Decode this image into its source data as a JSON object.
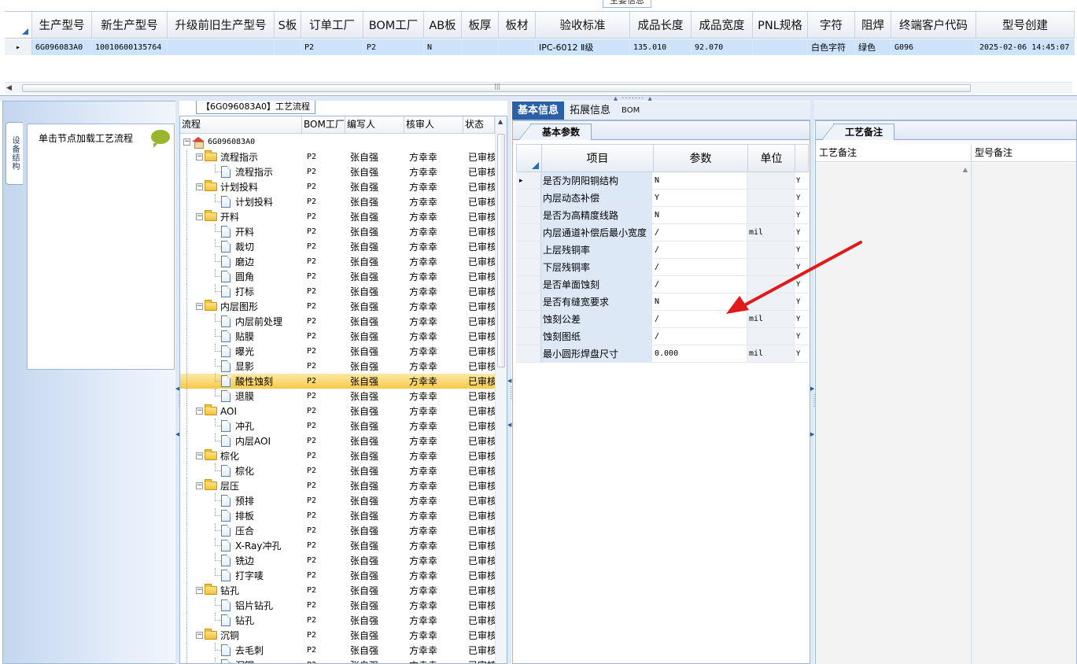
{
  "top_grid": {
    "caption": "主要信息",
    "columns": [
      {
        "label": "生产型号",
        "w": 76
      },
      {
        "label": "新生产型号",
        "w": 96
      },
      {
        "label": "升级前旧生产型号",
        "w": 136
      },
      {
        "label": "S板",
        "w": 34
      },
      {
        "label": "订单工厂",
        "w": 79
      },
      {
        "label": "BOM工厂",
        "w": 77
      },
      {
        "label": "AB板",
        "w": 48
      },
      {
        "label": "板厚",
        "w": 47
      },
      {
        "label": "板材",
        "w": 47
      },
      {
        "label": "验收标准",
        "w": 120
      },
      {
        "label": "成品长度",
        "w": 78
      },
      {
        "label": "成品宽度",
        "w": 78
      },
      {
        "label": "PNL规格",
        "w": 70
      },
      {
        "label": "字符",
        "w": 60
      },
      {
        "label": "阻焊",
        "w": 46
      },
      {
        "label": "终端客户代码",
        "w": 108
      },
      {
        "label": "型号创建",
        "w": 125
      }
    ],
    "row": [
      "6G096083A0",
      "10010600135764",
      "",
      "",
      "P2",
      "P2",
      "N",
      "",
      "",
      "IPC-6012 Ⅱ级",
      "135.010",
      "92.070",
      "",
      "白色字符",
      "绿色",
      "G096",
      "2025-02-06 14:45:07"
    ]
  },
  "sidebar": {
    "vertical_tab": "设备结构",
    "load_hint": "单击节点加载工艺流程"
  },
  "process": {
    "title": "【6G096083A0】工艺流程",
    "headers": [
      "流程",
      "BOM工厂",
      "编写人",
      "核审人",
      "状态"
    ],
    "root": "6G096083A0",
    "factory": "P2",
    "writer": "张自强",
    "reviewer": "方幸幸",
    "status": "已审核",
    "nodes": [
      {
        "label": "流程指示",
        "level": 1
      },
      {
        "label": "流程指示",
        "level": 2
      },
      {
        "label": "计划投料",
        "level": 1
      },
      {
        "label": "计划投料",
        "level": 2
      },
      {
        "label": "开料",
        "level": 1
      },
      {
        "label": "开料",
        "level": 2
      },
      {
        "label": "裁切",
        "level": 2
      },
      {
        "label": "磨边",
        "level": 2
      },
      {
        "label": "圆角",
        "level": 2
      },
      {
        "label": "打标",
        "level": 2
      },
      {
        "label": "内层图形",
        "level": 1
      },
      {
        "label": "内层前处理",
        "level": 2
      },
      {
        "label": "贴膜",
        "level": 2
      },
      {
        "label": "曝光",
        "level": 2
      },
      {
        "label": "显影",
        "level": 2
      },
      {
        "label": "酸性蚀刻",
        "level": 2,
        "selected": true
      },
      {
        "label": "退膜",
        "level": 2
      },
      {
        "label": "AOI",
        "level": 1
      },
      {
        "label": "冲孔",
        "level": 2
      },
      {
        "label": "内层AOI",
        "level": 2
      },
      {
        "label": "棕化",
        "level": 1
      },
      {
        "label": "棕化",
        "level": 2
      },
      {
        "label": "层压",
        "level": 1
      },
      {
        "label": "预排",
        "level": 2
      },
      {
        "label": "排板",
        "level": 2
      },
      {
        "label": "压合",
        "level": 2
      },
      {
        "label": "X-Ray冲孔",
        "level": 2
      },
      {
        "label": "铣边",
        "level": 2
      },
      {
        "label": "打字唛",
        "level": 2
      },
      {
        "label": "钻孔",
        "level": 1
      },
      {
        "label": "铝片钻孔",
        "level": 2
      },
      {
        "label": "钻孔",
        "level": 2
      },
      {
        "label": "沉铜",
        "level": 1
      },
      {
        "label": "去毛刺",
        "level": 2
      },
      {
        "label": "沉铜",
        "level": 2
      }
    ]
  },
  "info_tabs": [
    "基本信息",
    "拓展信息",
    "BOM"
  ],
  "basic": {
    "subtab": "基本参数",
    "headers": [
      "项目",
      "参数",
      "单位"
    ],
    "rows": [
      {
        "item": "是否为阴阳铜结构",
        "param": "N",
        "unit": "",
        "flag": "Y"
      },
      {
        "item": "内层动态补偿",
        "param": "Y",
        "unit": "",
        "flag": "Y"
      },
      {
        "item": "是否为高精度线路",
        "param": "N",
        "unit": "",
        "flag": "Y"
      },
      {
        "item": "内层通道补偿后最小宽度",
        "param": "/",
        "unit": "mil",
        "flag": "Y"
      },
      {
        "item": "上层残铜率",
        "param": "/",
        "unit": "",
        "flag": "Y"
      },
      {
        "item": "下层残铜率",
        "param": "/",
        "unit": "",
        "flag": "Y"
      },
      {
        "item": "是否单面蚀刻",
        "param": "/",
        "unit": "",
        "flag": "Y"
      },
      {
        "item": "是否有缝宽要求",
        "param": "N",
        "unit": "",
        "flag": "Y"
      },
      {
        "item": "蚀刻公差",
        "param": "/",
        "unit": "mil",
        "flag": "Y"
      },
      {
        "item": "蚀刻图纸",
        "param": "/",
        "unit": "",
        "flag": "Y"
      },
      {
        "item": "最小圆形焊盘尺寸",
        "param": "0.000",
        "unit": "mil",
        "flag": "Y"
      }
    ]
  },
  "notes": {
    "subtab": "工艺备注",
    "headers": [
      "工艺备注",
      "型号备注"
    ]
  },
  "colors": {
    "accent": "#2b5fa8",
    "selection": "#f7c949",
    "arrow": "#e01a1a"
  }
}
